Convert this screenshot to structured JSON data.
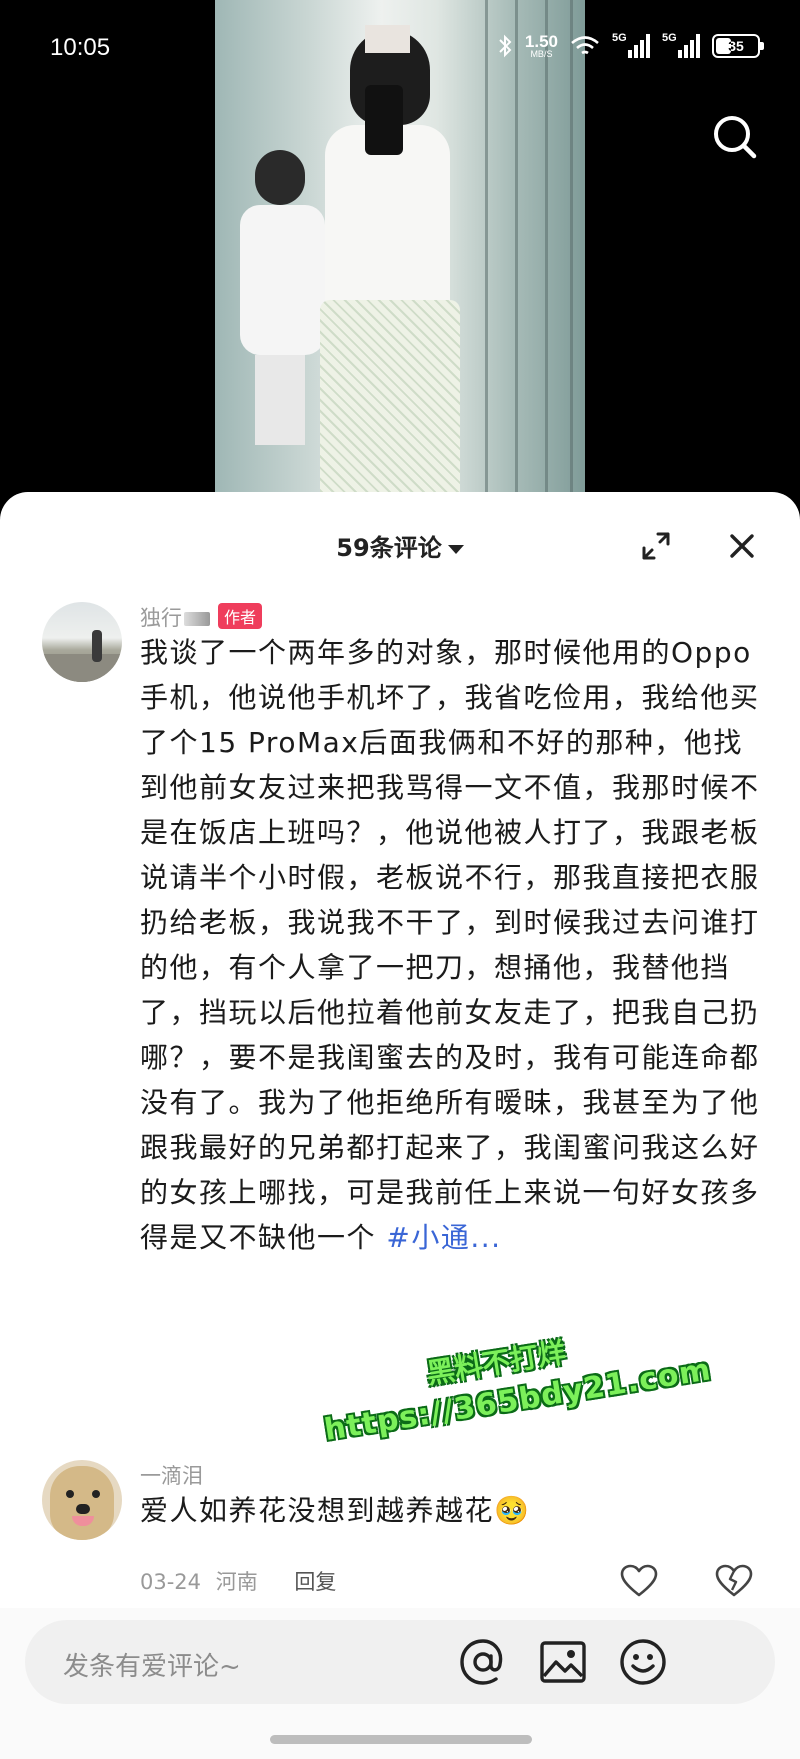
{
  "status_bar": {
    "time": "10:05",
    "net_speed_value": "1.50",
    "net_speed_unit": "MB/S",
    "sim1_label": "5G",
    "sim2_label": "5G",
    "battery_level": "35"
  },
  "sheet": {
    "title": "59条评论"
  },
  "comments": [
    {
      "username": "独行",
      "badge": "作者",
      "text": "我谈了一个两年多的对象，那时候他用的Oppo手机，他说他手机坏了，我省吃俭用，我给他买了个15 ProMax后面我俩和不好的那种，他找到他前女友过来把我骂得一文不值，我那时候不是在饭店上班吗？，他说他被人打了，我跟老板说请半个小时假，老板说不行，那我直接把衣服扔给老板，我说我不干了，到时候我过去问谁打的他，有个人拿了一把刀，想捅他，我替他挡了，挡玩以后他拉着他前女友走了，把我自己扔哪？，要不是我闺蜜去的及时，我有可能连命都没有了。我为了他拒绝所有暧昧，我甚至为了他跟我最好的兄弟都打起来了，我闺蜜问我这么好的女孩上哪找，可是我前任上来说一句好女孩多得是又不缺他一个 ",
      "hashtag": "#小通..."
    },
    {
      "username": "一滴泪",
      "text": "爱人如养花没想到越养越花",
      "emoji": "🥹",
      "date": "03-24",
      "location": "河南",
      "reply_label": "回复"
    }
  ],
  "watermark": {
    "line1": "黑料不打烊",
    "line2": "https://365bdy21.com"
  },
  "input": {
    "placeholder": "发条有爱评论~"
  }
}
